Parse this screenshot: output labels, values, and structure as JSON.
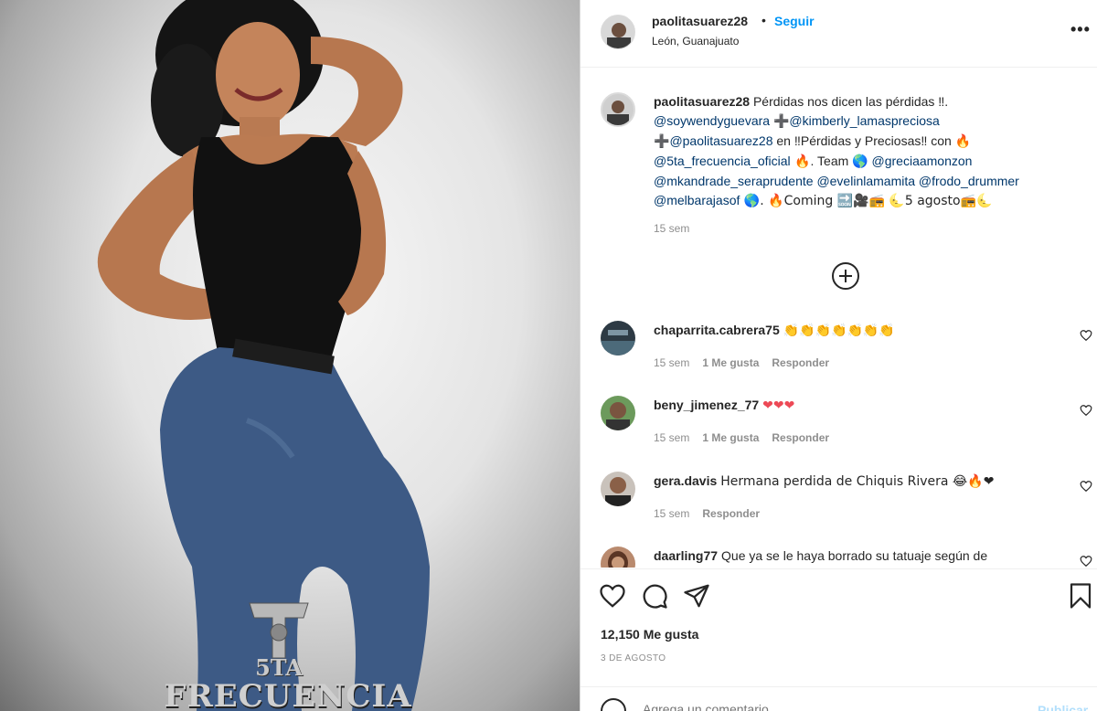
{
  "post": {
    "username": "paolitasuarez28",
    "follow_label": "Seguir",
    "dot": "•",
    "location": "León, Guanajuato",
    "more_label": "•••"
  },
  "caption": {
    "username": "paolitasuarez28",
    "line1": "Pérdidas nos dicen las pérdidas ‼.",
    "m1": "@soywendyguevara",
    "plus1": "➕",
    "m2": "@kimberly_lamaspreciosa",
    "plus2": "➕",
    "m3": "@paolitasuarez28",
    "text_en": " en ‼Pérdidas y Preciosas‼ con ",
    "fire1": "🔥",
    "m4": "@5ta_frecuencia_oficial",
    "fire2": " 🔥",
    "team": ". Team ",
    "globe1": "🌎",
    "m5": "@greciaamonzon",
    "m6": "@mkandrade_seraprudente",
    "m7": "@evelinlamamita",
    "m8": "@frodo_drummer",
    "m9": "@melbarajasof",
    "globe2": " 🌎",
    "coming": ". 🔥Coming 🔜🎥📻 🌜5 agosto📻🌜",
    "time": "15 sem"
  },
  "comments": [
    {
      "username": "chaparrita.cabrera75",
      "text": "👏👏👏👏👏👏👏",
      "time": "15 sem",
      "likes": "1 Me gusta",
      "reply": "Responder"
    },
    {
      "username": "beny_jimenez_77",
      "text": "❤❤❤",
      "time": "15 sem",
      "likes": "1 Me gusta",
      "reply": "Responder"
    },
    {
      "username": "gera.davis",
      "text": "Hermana perdida de Chiquis Rivera 😂🔥❤",
      "time": "15 sem",
      "reply": "Responder"
    },
    {
      "username": "daarling77",
      "text": "Que ya se le haya borrado su tatuaje según de"
    }
  ],
  "footer": {
    "likes": "12,150 Me gusta",
    "date": "3 DE AGOSTO",
    "add_comment_placeholder": "Agrega un comentario...",
    "publish_label": "Publicar"
  },
  "photo": {
    "brand_top": "5TA",
    "brand_bottom": "FRECUENCIA"
  },
  "colors": {
    "accent": "#0095f6",
    "mention": "#00376b",
    "meta": "#8e8e8e",
    "heart": "#ed4956"
  }
}
